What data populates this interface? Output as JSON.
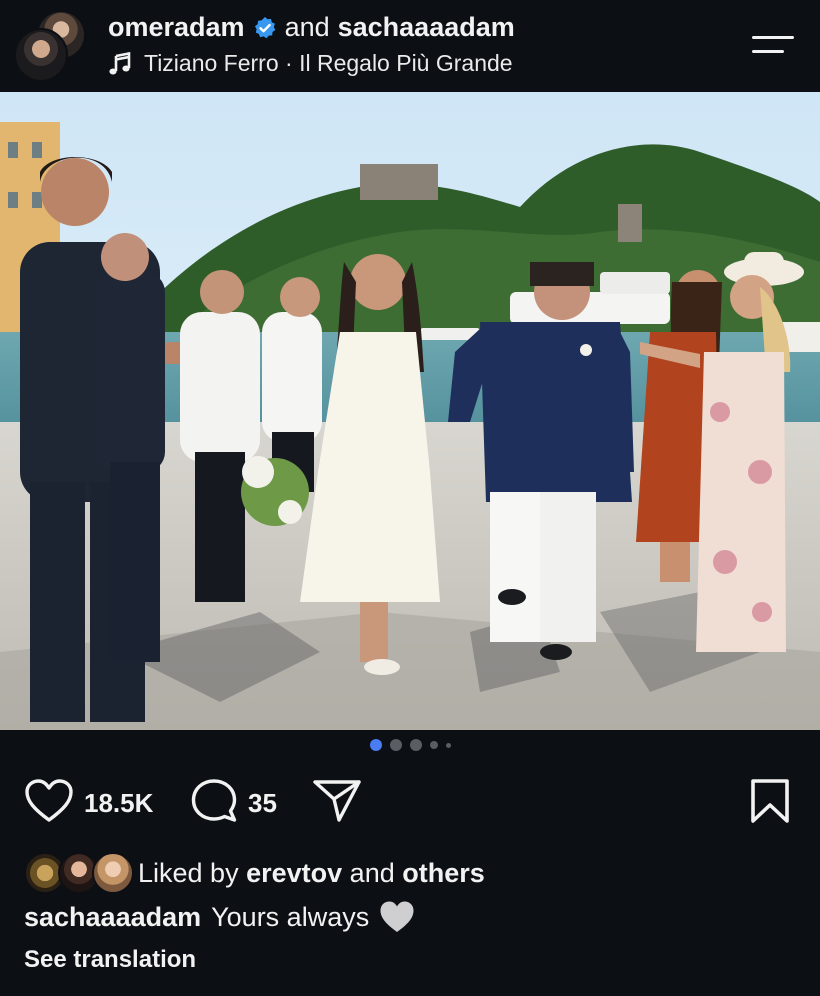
{
  "header": {
    "user1": "omeradam",
    "connector": "and",
    "user2": "sachaaaadam",
    "music_icon": "music-note-icon",
    "song": "Tiziano Ferro · Il Regalo Più Grande",
    "menu_icon": "hamburger-menu-icon",
    "verified_color": "#3897f0"
  },
  "carousel": {
    "total": 5,
    "active": 1,
    "active_color": "#4a7df2"
  },
  "actions": {
    "like_icon": "heart-icon",
    "like_count": "18.5K",
    "comment_icon": "comment-icon",
    "comment_count": "35",
    "share_icon": "send-icon",
    "save_icon": "bookmark-icon"
  },
  "likes": {
    "prefix": "Liked by",
    "user": "erevtov",
    "connector": "and",
    "others": "others"
  },
  "caption": {
    "username": "sachaaaadam",
    "text": "Yours always",
    "emoji": "white-heart-emoji"
  },
  "translation_link": "See translation"
}
